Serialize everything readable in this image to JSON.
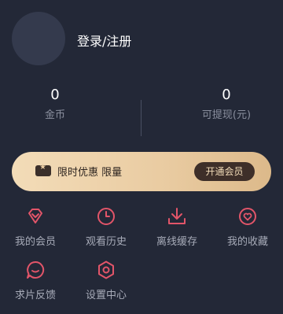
{
  "user": {
    "login_label": "登录/注册"
  },
  "stats": [
    {
      "value": "0",
      "label": "金币"
    },
    {
      "value": "0",
      "label": "可提现(元)"
    }
  ],
  "vip_banner": {
    "text": "限时优惠 限量",
    "button": "开通会员"
  },
  "grid": [
    {
      "label": "我的会员",
      "icon": "diamond-icon"
    },
    {
      "label": "观看历史",
      "icon": "clock-icon"
    },
    {
      "label": "离线缓存",
      "icon": "download-icon"
    },
    {
      "label": "我的收藏",
      "icon": "heart-icon"
    },
    {
      "label": "求片反馈",
      "icon": "chat-icon"
    },
    {
      "label": "设置中心",
      "icon": "gear-icon"
    }
  ],
  "colors": {
    "background": "#232837",
    "accent": "#e25569",
    "vip_gold": "#e9cba1",
    "vip_button": "#3e2f29"
  }
}
